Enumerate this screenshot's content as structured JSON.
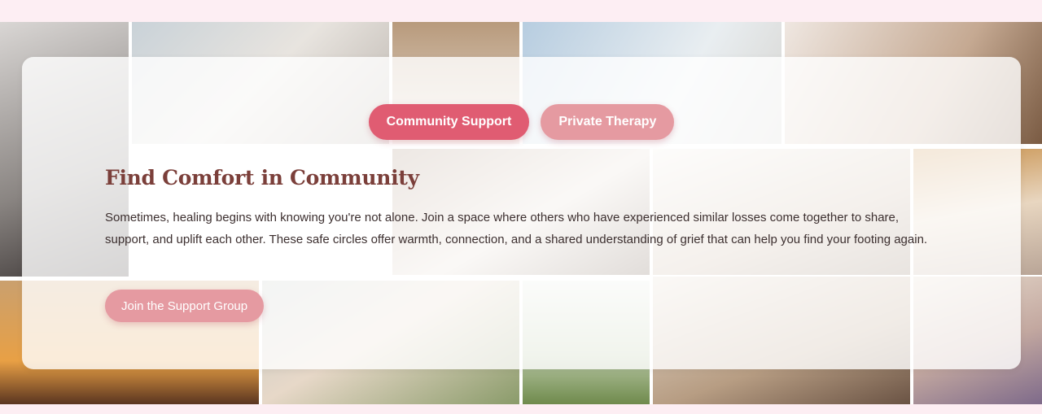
{
  "tabs": [
    {
      "label": "Community Support",
      "active": true
    },
    {
      "label": "Private Therapy",
      "active": false
    }
  ],
  "section": {
    "title": "Find Comfort in Community",
    "description": "Sometimes, healing begins with knowing you're not alone. Join a space where others who have experienced similar losses come together to share, support, and uplift each other. These safe circles offer warmth, connection, and a shared understanding of grief that can help you find your footing again.",
    "cta_label": "Join the Support Group"
  },
  "colors": {
    "page_background": "#fdeef3",
    "tab_active": "#e05c72",
    "tab_inactive": "#e59aa1",
    "heading": "#7b3f3a",
    "body_text": "#3c2f2f"
  }
}
